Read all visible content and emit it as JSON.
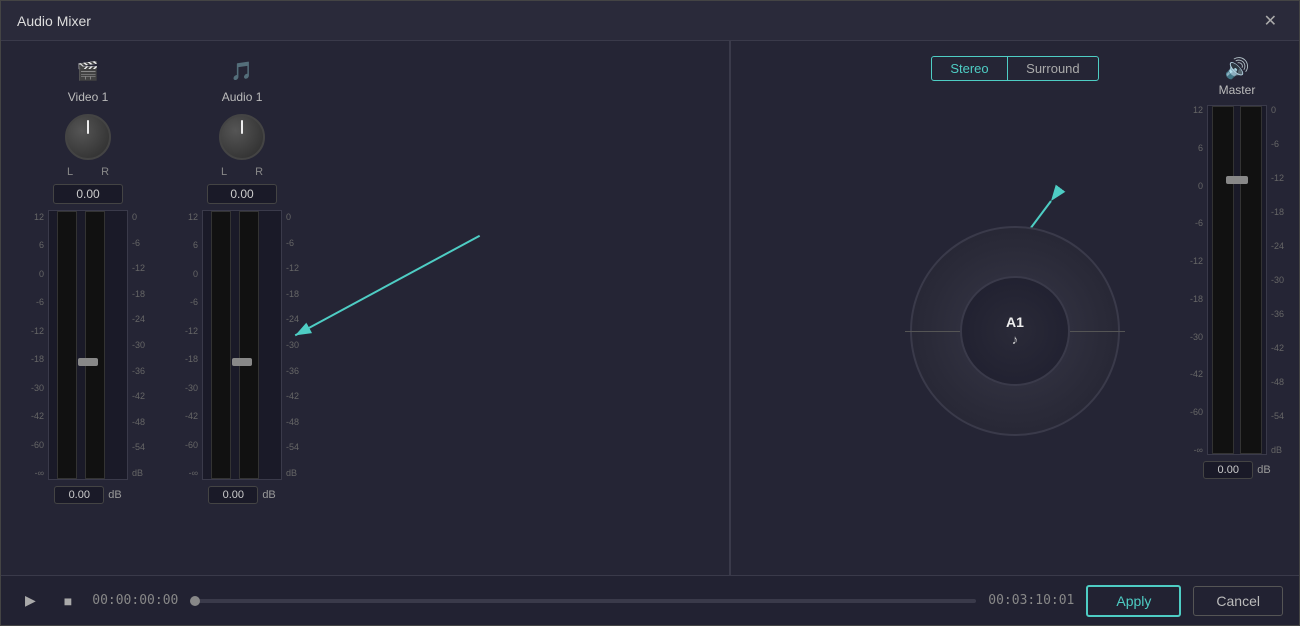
{
  "window": {
    "title": "Audio Mixer"
  },
  "channels": [
    {
      "id": "video1",
      "icon": "🎬",
      "label": "Video  1",
      "knob_value": "0",
      "fader_value": "0.00",
      "db_label": "dB",
      "lr_l": "L",
      "lr_r": "R",
      "scale_left": [
        "12",
        "6",
        "0",
        "-6",
        "-12",
        "-18",
        "-30",
        "-42",
        "-60",
        "-∞"
      ],
      "scale_right": [
        "0",
        "-6",
        "-12",
        "-18",
        "-24",
        "-30",
        "-36",
        "-42",
        "-48",
        "-54",
        "dB"
      ]
    },
    {
      "id": "audio1",
      "icon": "🎵",
      "label": "Audio  1",
      "knob_value": "0",
      "fader_value": "0.00",
      "db_label": "dB",
      "lr_l": "L",
      "lr_r": "R",
      "scale_left": [
        "12",
        "6",
        "0",
        "-6",
        "-12",
        "-18",
        "-30",
        "-42",
        "-60",
        "-∞"
      ],
      "scale_right": [
        "0",
        "-6",
        "-12",
        "-18",
        "-24",
        "-30",
        "-36",
        "-42",
        "-48",
        "-54",
        "dB"
      ]
    }
  ],
  "surround": {
    "stereo_label": "Stereo",
    "surround_label": "Surround",
    "audio_node_label": "A1",
    "audio_node_icon": "♪"
  },
  "master": {
    "icon": "🔊",
    "label": "Master",
    "fader_value": "0.00",
    "db_label": "dB",
    "scale_left": [
      "12",
      "6",
      "0",
      "-6",
      "-12",
      "-18",
      "-30",
      "-42",
      "-60",
      "-∞"
    ],
    "scale_right": [
      "0",
      "-6",
      "-12",
      "-18",
      "-24",
      "-30",
      "-36",
      "-42",
      "-48",
      "-54",
      "dB"
    ]
  },
  "transport": {
    "play_icon": "▶",
    "stop_icon": "■",
    "timecode": "00:00:00:00",
    "duration": "00:03:10:01"
  },
  "buttons": {
    "apply": "Apply",
    "cancel": "Cancel"
  },
  "colors": {
    "accent": "#4ecdc4",
    "red": "#e05555"
  }
}
